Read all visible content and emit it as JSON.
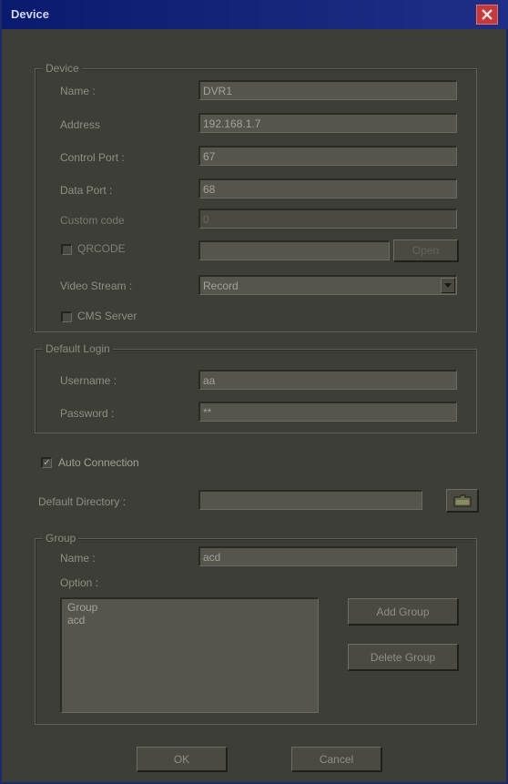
{
  "window": {
    "title": "Device",
    "close_icon": "close-icon"
  },
  "device_group": {
    "legend": "Device",
    "name_label": "Name :",
    "name_value": "DVR1",
    "address_label": "Address",
    "address_value": "192.168.1.7",
    "control_port_label": "Control Port :",
    "control_port_value": "67",
    "data_port_label": "Data Port :",
    "data_port_value": "68",
    "custom_code_label": "Custom code",
    "custom_code_value": "0",
    "qrcode_label": "QRCODE",
    "qrcode_checked": false,
    "qrcode_value": "",
    "open_label": "Open",
    "video_stream_label": "Video Stream :",
    "video_stream_value": "Record",
    "cms_server_label": "CMS Server",
    "cms_server_checked": false
  },
  "default_login": {
    "legend": "Default Login",
    "username_label": "Username :",
    "username_value": "aa",
    "password_label": "Password :",
    "password_value": "**"
  },
  "auto_connection": {
    "label": "Auto Connection",
    "checked": true,
    "check_glyph": "✓"
  },
  "default_directory": {
    "label": "Default Directory :",
    "value": "",
    "browse_icon": "folder-icon"
  },
  "group": {
    "legend": "Group",
    "name_label": "Name :",
    "name_value": "acd",
    "option_label": "Option :",
    "options": [
      "Group",
      "acd"
    ],
    "add_group_label": "Add Group",
    "delete_group_label": "Delete Group"
  },
  "footer": {
    "ok_label": "OK",
    "cancel_label": "Cancel"
  }
}
